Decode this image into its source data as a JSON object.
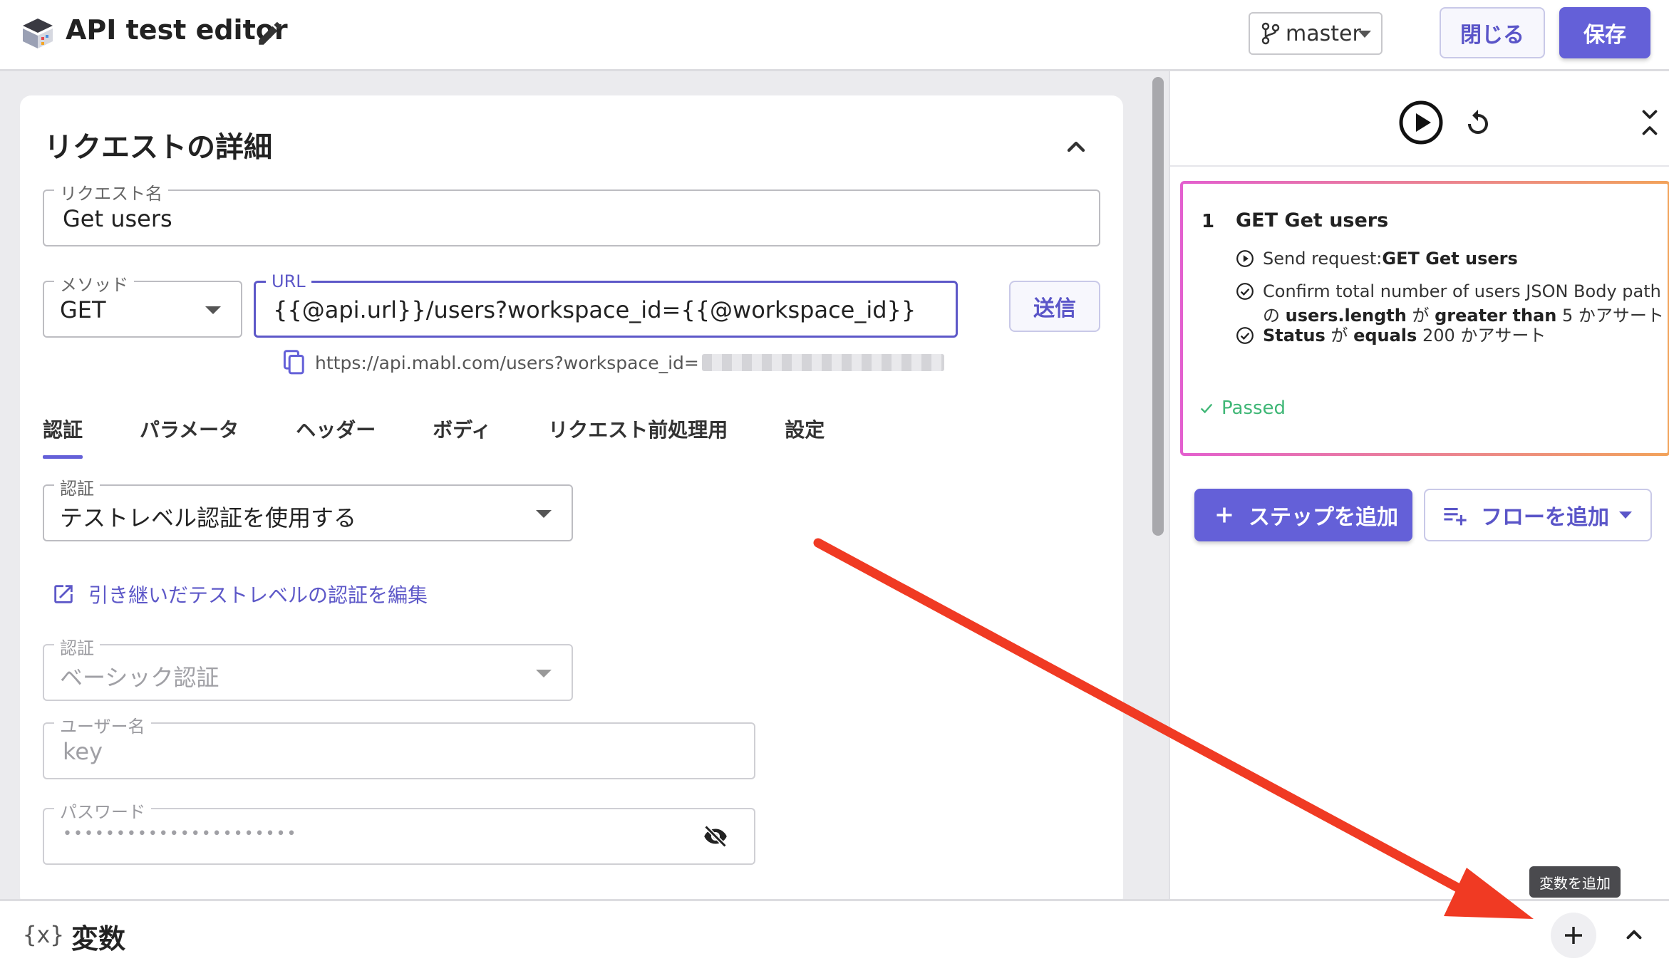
{
  "header": {
    "app_title": "API test editor",
    "branch": "master",
    "close_label": "閉じる",
    "save_label": "保存"
  },
  "request_details": {
    "title": "リクエストの詳細",
    "name_label": "リクエスト名",
    "name_value": "Get users",
    "method_label": "メソッド",
    "method_value": "GET",
    "url_label": "URL",
    "url_value": "{{@api.url}}/users?workspace_id={{@workspace_id}}",
    "send_label": "送信",
    "resolved_url": "https://api.mabl.com/users?workspace_id="
  },
  "tabs": [
    {
      "label": "認証"
    },
    {
      "label": "パラメータ"
    },
    {
      "label": "ヘッダー"
    },
    {
      "label": "ボディ"
    },
    {
      "label": "リクエスト前処理用"
    },
    {
      "label": "設定"
    }
  ],
  "auth": {
    "auth_label": "認証",
    "auth_value": "テストレベル認証を使用する",
    "edit_link": "引き継いだテストレベルの認証を編集",
    "type_label": "認証",
    "type_value": "ベーシック認証",
    "username_label": "ユーザー名",
    "username_value": "key",
    "password_label": "パスワード",
    "password_value": "••••••••••••••••••••••"
  },
  "steps": {
    "number": "1",
    "title": "GET Get users",
    "send_prefix": "Send request:",
    "send_bold": "GET Get users",
    "confirm_text": "Confirm total number of users JSON Body path",
    "confirm_line2_a": "の ",
    "confirm_path": "users.length",
    "confirm_line2_b": " が ",
    "confirm_op": "greater than",
    "confirm_line2_c": " 5 かアサート",
    "status_bold": "Status",
    "status_mid": " が ",
    "status_op": "equals",
    "status_tail": " 200 かアサート",
    "result": "Passed",
    "add_step_label": "ステップを追加",
    "add_flow_label": "フローを追加"
  },
  "variables": {
    "icon_text": "{x}",
    "title": "変数",
    "add_tooltip": "変数を追加"
  },
  "colors": {
    "accent": "#6460d8",
    "passed": "#3fb776",
    "annotation_arrow": "#f03a23"
  }
}
